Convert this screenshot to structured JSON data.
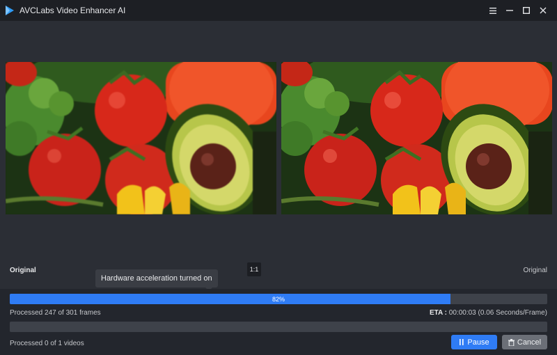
{
  "window": {
    "title": "AVCLabs Video Enhancer AI",
    "menu_icon": "hamburger-menu-icon",
    "minimize_icon": "minimize-icon",
    "maximize_icon": "maximize-icon",
    "close_icon": "close-icon"
  },
  "preview": {
    "left_label": "Original",
    "right_label": "Original",
    "ratio_button": "1:1"
  },
  "tooltip": {
    "text": "Hardware acceleration turned on"
  },
  "progress": {
    "frames_percent": 82,
    "frames_percent_label": "82%",
    "frames_text": "Processed 247 of 301 frames",
    "eta_label": "ETA :",
    "eta_value": "00:00:03 (0.06 Seconds/Frame)",
    "videos_percent": 0,
    "videos_text": "Processed 0 of 1 videos"
  },
  "actions": {
    "pause_label": "Pause",
    "pause_icon": "pause-icon",
    "cancel_label": "Cancel",
    "cancel_icon": "trash-icon"
  },
  "colors": {
    "accent": "#2f7cf5",
    "titlebar": "#1d1f24",
    "background": "#23262d",
    "preview_background": "#2b2e35"
  }
}
